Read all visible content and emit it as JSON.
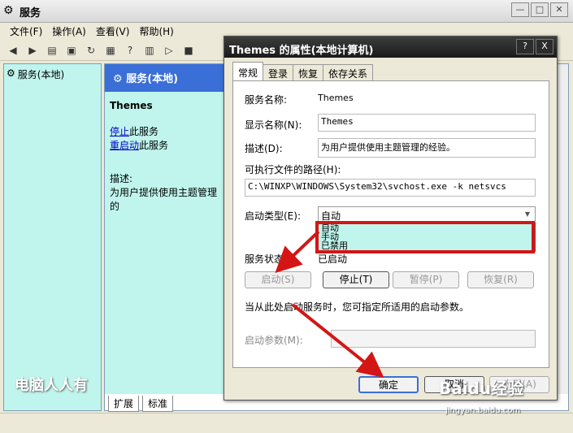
{
  "window": {
    "title": "服务",
    "icon": "gear-icon"
  },
  "menu": [
    "文件(F)",
    "操作(A)",
    "查看(V)",
    "帮助(H)"
  ],
  "tree": {
    "node": "服务(本地)"
  },
  "content": {
    "header": "服务(本地)",
    "service_name": "Themes",
    "stop_link": "停止",
    "stop_suffix": "此服务",
    "restart_link": "重启动",
    "restart_suffix": "此服务",
    "desc_label": "描述:",
    "desc_text": "为用户提供使用主题管理的",
    "tabs": [
      "扩展",
      "标准"
    ]
  },
  "dialog": {
    "title": "Themes 的属性(本地计算机)",
    "tabs": [
      "常规",
      "登录",
      "恢复",
      "依存关系"
    ],
    "labels": {
      "service_name": "服务名称:",
      "display_name": "显示名称(N):",
      "description": "描述(D):",
      "exe_path": "可执行文件的路径(H):",
      "startup_type": "启动类型(E):",
      "service_status": "服务状态:",
      "hint": "当从此处启动服务时，您可指定所适用的启动参数。",
      "start_params": "启动参数(M):"
    },
    "values": {
      "service_name": "Themes",
      "display_name": "Themes",
      "description": "为用户提供使用主题管理的经验。",
      "exe_path": "C:\\WINXP\\WINDOWS\\System32\\svchost.exe -k netsvcs",
      "startup_type": "自动",
      "service_status": "已启动"
    },
    "startup_options": [
      "自动",
      "手动",
      "已禁用"
    ],
    "service_buttons": [
      "启动(S)",
      "停止(T)",
      "暂停(P)",
      "恢复(R)"
    ],
    "buttons": {
      "ok": "确定",
      "cancel": "取消",
      "apply": "应用(A)"
    },
    "help_button": "?",
    "close_button": "X"
  },
  "watermark": "电脑人人有",
  "baidu": "Baidu经验",
  "baidu_url": "jingyan.baidu.com",
  "accent_colors": {
    "highlight": "#d41515",
    "cyan": "#bff5ec",
    "blue": "#3a6fd8"
  }
}
